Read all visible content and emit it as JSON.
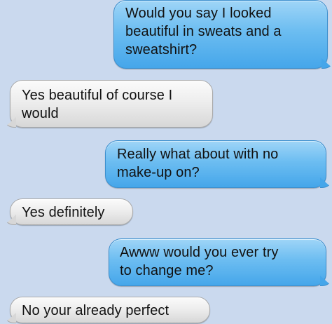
{
  "messages": [
    {
      "sender": "me",
      "text": "Would you say I looked\nbeautiful in sweats and a\nsweatshirt?"
    },
    {
      "sender": "them",
      "text": "Yes beautiful of course I\nwould"
    },
    {
      "sender": "me",
      "text": "Really what about with no\nmake-up on?"
    },
    {
      "sender": "them",
      "text": "Yes definitely"
    },
    {
      "sender": "me",
      "text": "Awww would you ever try\nto change me?"
    },
    {
      "sender": "them",
      "text": "No your already perfect"
    }
  ],
  "colors": {
    "background": "#cad9ee",
    "sent_bubble": "#6cbdf1",
    "received_bubble": "#ececec"
  }
}
